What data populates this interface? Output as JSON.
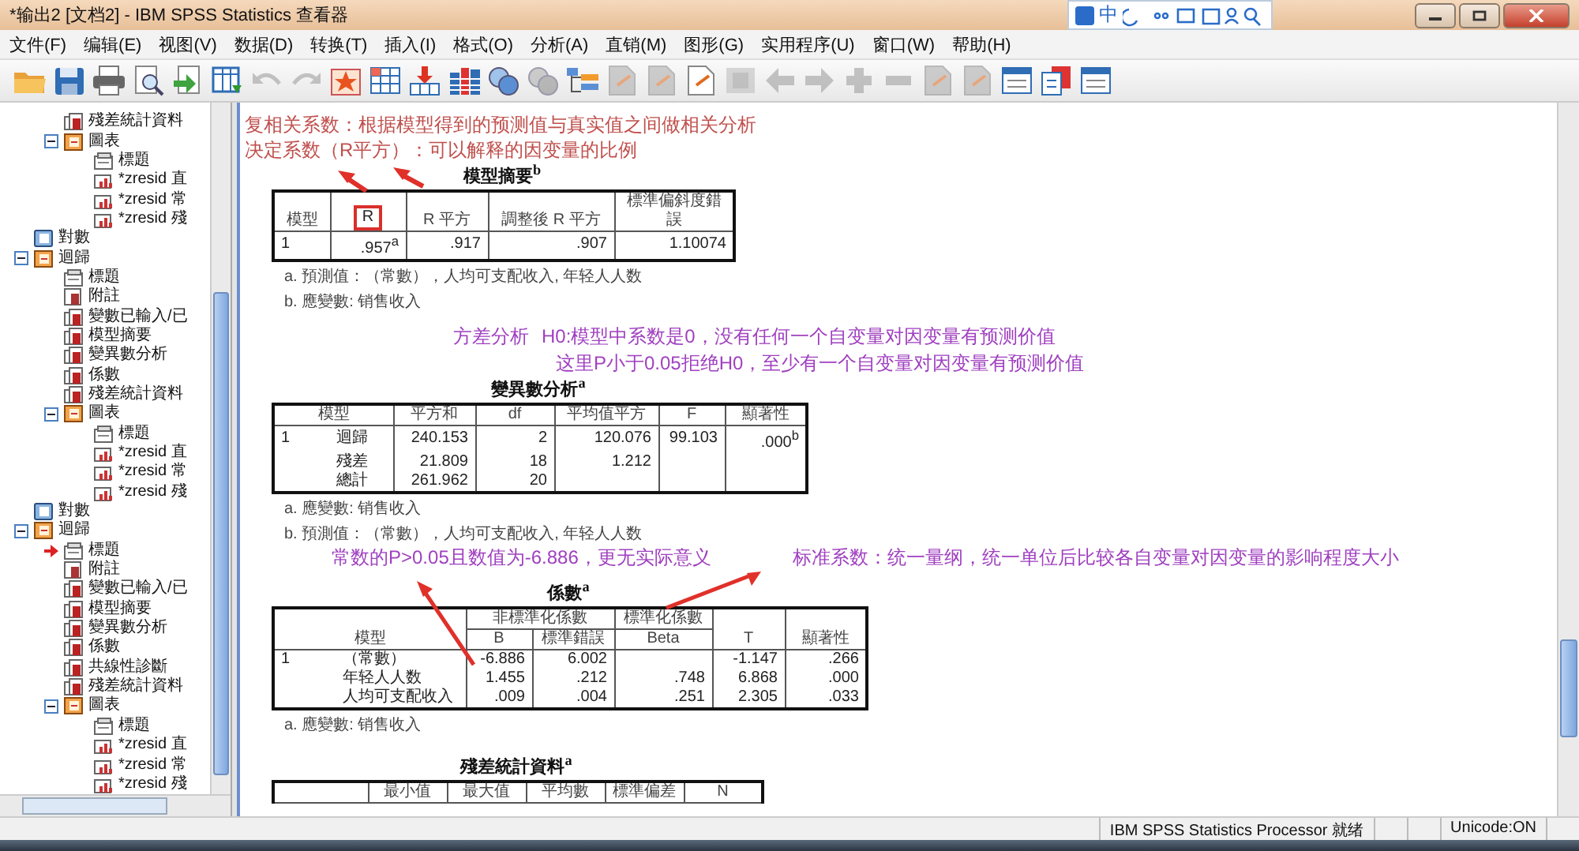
{
  "window": {
    "title": "*输出2 [文档2] - IBM SPSS Statistics 查看器",
    "ime_label": "中"
  },
  "menu": [
    "文件(F)",
    "编辑(E)",
    "视图(V)",
    "数据(D)",
    "转换(T)",
    "插入(I)",
    "格式(O)",
    "分析(A)",
    "直销(M)",
    "图形(G)",
    "实用程序(U)",
    "窗口(W)",
    "帮助(H)"
  ],
  "toolbar": [
    {
      "kind": "folder",
      "disabled": false
    },
    {
      "kind": "disk",
      "disabled": false
    },
    {
      "kind": "printer",
      "disabled": false
    },
    {
      "kind": "preview",
      "disabled": false
    },
    {
      "kind": "export",
      "disabled": false
    },
    {
      "kind": "grid",
      "disabled": false
    },
    {
      "kind": "undo",
      "disabled": true
    },
    {
      "kind": "redo",
      "disabled": true
    },
    {
      "kind": "star",
      "disabled": false
    },
    {
      "kind": "table",
      "disabled": false
    },
    {
      "kind": "insert",
      "disabled": false
    },
    {
      "kind": "bars",
      "disabled": false
    },
    {
      "kind": "circles",
      "disabled": false
    },
    {
      "kind": "circles",
      "disabled": true
    },
    {
      "kind": "tree",
      "disabled": false
    },
    {
      "kind": "page",
      "disabled": true
    },
    {
      "kind": "page",
      "disabled": true
    },
    {
      "kind": "page",
      "disabled": false
    },
    {
      "kind": "square",
      "disabled": true
    },
    {
      "kind": "arrow-left",
      "disabled": true
    },
    {
      "kind": "arrow-right",
      "disabled": true
    },
    {
      "kind": "plus",
      "disabled": true
    },
    {
      "kind": "minus",
      "disabled": true
    },
    {
      "kind": "page",
      "disabled": true
    },
    {
      "kind": "page",
      "disabled": true
    },
    {
      "kind": "window",
      "disabled": false
    },
    {
      "kind": "pages",
      "disabled": false
    },
    {
      "kind": "window",
      "disabled": false
    }
  ],
  "tree": {
    "items": [
      {
        "children": [
          {
            "label": "殘差統計資料",
            "kind": "table",
            "current": false
          },
          {
            "label": "圖表",
            "kind": "folder",
            "current": false,
            "expanded": true,
            "children": [
              {
                "label": "標題",
                "kind": "title",
                "current": false
              },
              {
                "label": "*zresid 直",
                "kind": "chart",
                "current": false
              },
              {
                "label": "*zresid 常",
                "kind": "chart",
                "current": false
              },
              {
                "label": "*zresid 殘",
                "kind": "chart",
                "current": false
              }
            ]
          }
        ]
      },
      {
        "label": "對數",
        "kind": "log",
        "current": false
      },
      {
        "label": "迴歸",
        "kind": "folder",
        "current": false,
        "expanded": true,
        "children": [
          {
            "label": "標題",
            "kind": "title",
            "current": false
          },
          {
            "label": "附註",
            "kind": "note",
            "current": false
          },
          {
            "label": "變數已輸入/已",
            "kind": "table",
            "current": false
          },
          {
            "label": "模型摘要",
            "kind": "table",
            "current": false
          },
          {
            "label": "變異數分析",
            "kind": "table",
            "current": false
          },
          {
            "label": "係數",
            "kind": "table",
            "current": false
          },
          {
            "label": "殘差統計資料",
            "kind": "table",
            "current": false
          },
          {
            "label": "圖表",
            "kind": "folder",
            "current": false,
            "expanded": true,
            "children": [
              {
                "label": "標題",
                "kind": "title",
                "current": false
              },
              {
                "label": "*zresid 直",
                "kind": "chart",
                "current": false
              },
              {
                "label": "*zresid 常",
                "kind": "chart",
                "current": false
              },
              {
                "label": "*zresid 殘",
                "kind": "chart",
                "current": false
              }
            ]
          }
        ]
      },
      {
        "label": "對數",
        "kind": "log",
        "current": false
      },
      {
        "label": "迴歸",
        "kind": "folder",
        "current": false,
        "expanded": true,
        "children": [
          {
            "label": "標題",
            "kind": "title",
            "current": true
          },
          {
            "label": "附註",
            "kind": "note",
            "current": false
          },
          {
            "label": "變數已輸入/已",
            "kind": "table",
            "current": false
          },
          {
            "label": "模型摘要",
            "kind": "table",
            "current": false
          },
          {
            "label": "變異數分析",
            "kind": "table",
            "current": false
          },
          {
            "label": "係數",
            "kind": "table",
            "current": false
          },
          {
            "label": "共線性診斷",
            "kind": "table",
            "current": false
          },
          {
            "label": "殘差統計資料",
            "kind": "table",
            "current": false
          },
          {
            "label": "圖表",
            "kind": "folder",
            "current": false,
            "expanded": true,
            "children": [
              {
                "label": "標題",
                "kind": "title",
                "current": false
              },
              {
                "label": "*zresid 直",
                "kind": "chart",
                "current": false
              },
              {
                "label": "*zresid 常",
                "kind": "chart",
                "current": false
              },
              {
                "label": "*zresid 殘",
                "kind": "chart",
                "current": false
              }
            ]
          }
        ]
      }
    ]
  },
  "sections": [
    {
      "annotations": [
        {
          "text": "复相关系数：根据模型得到的预测值与真实值之间做相关分析",
          "color": "#c0504d"
        },
        {
          "text": "决定系数（R平方）：可以解释的因变量的比例",
          "color": "#c0504d"
        }
      ],
      "title": "模型摘要$^{b}$",
      "table": {
        "header": [
          [
            {
              "text": "模型"
            },
            {
              "text": "R",
              "highlighted": true
            },
            {
              "text": "R 平方"
            },
            {
              "text": "調整後 R 平方"
            },
            {
              "text": "標準偏斜度錯誤"
            }
          ]
        ],
        "rows": [
          [
            "1",
            ".957$^{a}$",
            ".917",
            ".907",
            "1.10074"
          ]
        ]
      },
      "footnotes": [
        "a. 預測值：（常數），人均可支配收入, 年轻人人数",
        "b. 應變數: 销售收入"
      ]
    },
    {
      "annotations": [
        {
          "text": "方差分析",
          "color": "#a040c0"
        },
        {
          "text": "H0:模型中系数是0，没有任何一个自变量对因变量有预测价值",
          "color": "#a040c0"
        },
        {
          "text": "这里P小于0.05拒绝H0，至少有一个自变量对因变量有预测价值",
          "color": "#a040c0"
        }
      ],
      "title": "變異數分析$^{a}$",
      "table": {
        "header": [
          [
            {
              "text": "模型",
              "colspan": 2
            },
            {
              "text": "平方和"
            },
            {
              "text": "df"
            },
            {
              "text": "平均值平方"
            },
            {
              "text": "F"
            },
            {
              "text": "顯著性"
            }
          ]
        ],
        "rows": [
          [
            "1",
            "迴歸",
            "240.153",
            "2",
            "120.076",
            "99.103",
            ".000$^{b}$"
          ],
          [
            null,
            "殘差",
            "21.809",
            "18",
            "1.212",
            null,
            null
          ],
          [
            null,
            "總計",
            "261.962",
            "20",
            null,
            null,
            null
          ]
        ]
      },
      "footnotes": [
        "a. 應變數: 销售收入",
        "b. 預測值：（常數），人均可支配收入, 年轻人人数"
      ]
    },
    {
      "annotations": [
        {
          "text": "常数的P>0.05且数值为-6.886，更无实际意义",
          "color": "#a040c0"
        },
        {
          "text": "标准系数：统一量纲，统一单位后比较各自变量对因变量的影响程度大小",
          "color": "#a040c0"
        }
      ],
      "title": "係數$^{a}$",
      "table": {
        "header": [
          [
            {
              "text": "模型",
              "colspan": 2,
              "rowspan": 2
            },
            {
              "text": "非標準化係數",
              "colspan": 2
            },
            {
              "text": "標準化係數"
            },
            {
              "text": "T",
              "rowspan": 2
            },
            {
              "text": "顯著性",
              "rowspan": 2
            }
          ],
          [
            {
              "text": "B"
            },
            {
              "text": "標準錯誤"
            },
            {
              "text": "Beta"
            }
          ]
        ],
        "rows": [
          [
            "1",
            "（常數）",
            "-6.886",
            "6.002",
            null,
            "-1.147",
            ".266"
          ],
          [
            null,
            "年轻人人数",
            "1.455",
            ".212",
            ".748",
            "6.868",
            ".000"
          ],
          [
            null,
            "人均可支配收入",
            ".009",
            ".004",
            ".251",
            "2.305",
            ".033"
          ]
        ]
      },
      "footnotes": [
        "a. 應變數: 销售收入"
      ]
    },
    {
      "title": "殘差統計資料$^{a}$",
      "table": {
        "leading_blank": true,
        "header": [
          [
            {
              "text": "最小值"
            },
            {
              "text": "最大值"
            },
            {
              "text": "平均數"
            },
            {
              "text": "標準偏差"
            },
            {
              "text": "N"
            }
          ]
        ]
      }
    }
  ],
  "status_bar": {
    "processor": "IBM SPSS Statistics Processor 就绪",
    "unicode": "Unicode:ON"
  }
}
